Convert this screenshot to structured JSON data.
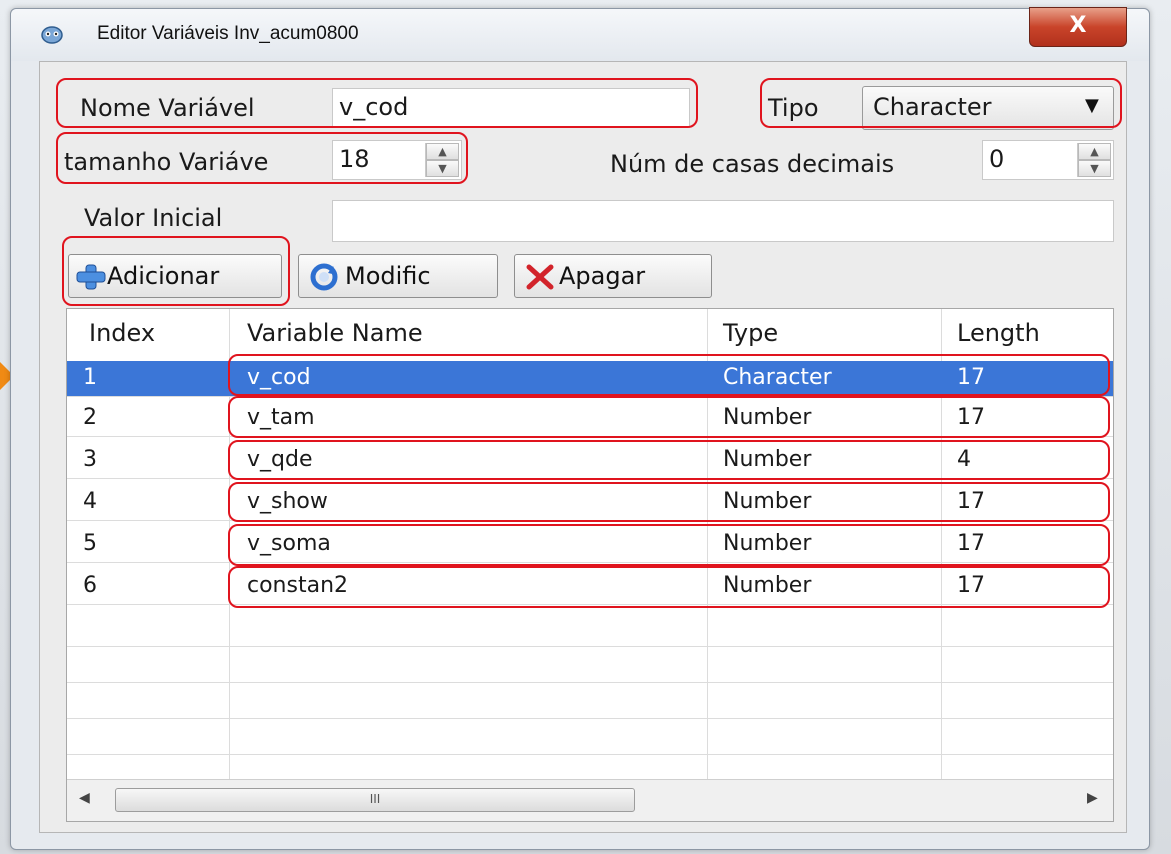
{
  "window": {
    "title": "Editor Variáveis  Inv_acum0800",
    "close_glyph": "X"
  },
  "form": {
    "nome_label": "Nome Variável",
    "nome_value": "v_cod",
    "tipo_label": "Tipo",
    "tipo_value": "Character",
    "tamanho_label": "tamanho Variáve",
    "tamanho_value": "18",
    "casas_label": "Núm de casas decimais",
    "casas_value": "0",
    "valor_label": "Valor Inicial",
    "valor_value": ""
  },
  "toolbar": {
    "add_label": "Adicionar",
    "modify_label": "Modific",
    "delete_label": "Apagar"
  },
  "table": {
    "columns": [
      "Index",
      "Variable Name",
      "Type",
      "Length"
    ],
    "rows": [
      [
        "1",
        "v_cod",
        "Character",
        "17"
      ],
      [
        "2",
        "v_tam",
        "Number",
        "17"
      ],
      [
        "3",
        "v_qde",
        "Number",
        "4"
      ],
      [
        "4",
        "v_show",
        "Number",
        "17"
      ],
      [
        "5",
        "v_soma",
        "Number",
        "17"
      ],
      [
        "6",
        "constan2",
        "Number",
        "17"
      ]
    ],
    "selected_row": 0,
    "scroll_grip": "III"
  },
  "colors": {
    "highlight": "#e0141e",
    "selection": "#3b76d7",
    "arrow": "#f08a14"
  },
  "icons": {
    "app": "app-icon",
    "add": "add-icon",
    "modify": "refresh-icon",
    "delete": "delete-icon"
  }
}
